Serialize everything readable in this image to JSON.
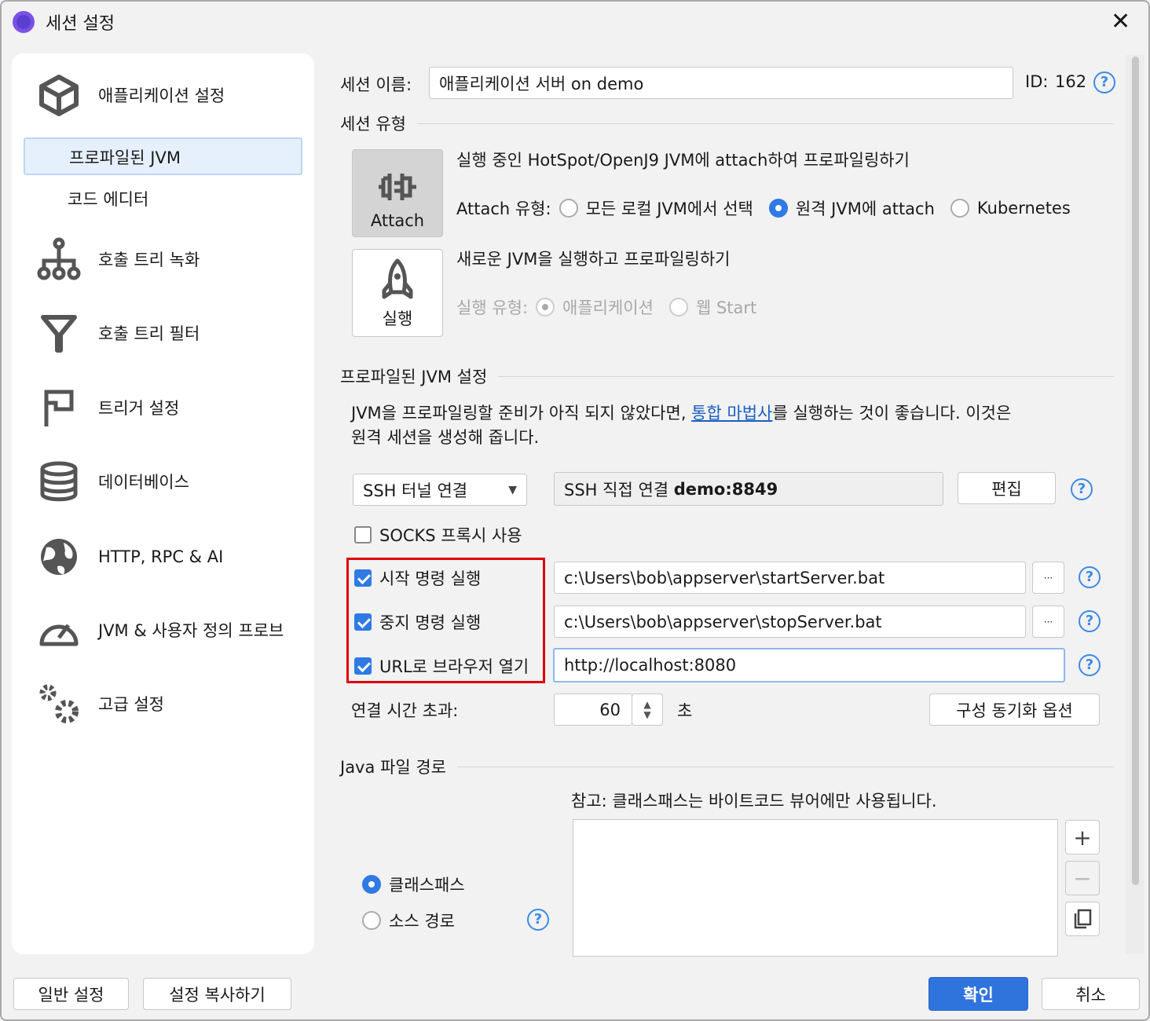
{
  "window": {
    "title": "세션 설정",
    "close": "✕"
  },
  "sidebar": {
    "app_settings": "애플리케이션 설정",
    "sub_items": [
      "프로파일된 JVM",
      "코드 에디터"
    ],
    "items": [
      "호출 트리 녹화",
      "호출 트리 필터",
      "트리거 설정",
      "데이터베이스",
      "HTTP, RPC & AI",
      "JVM & 사용자 정의 프로브",
      "고급 설정"
    ]
  },
  "session": {
    "name_label": "세션 이름:",
    "name_value": "애플리케이션 서버 on demo",
    "id_label": "ID:",
    "id_value": "162"
  },
  "session_type": {
    "header": "세션 유형",
    "attach_tile": "Attach",
    "attach_desc": "실행 중인 HotSpot/OpenJ9 JVM에 attach하여 프로파일링하기",
    "attach_type_label": "Attach 유형:",
    "attach_options": [
      "모든 로컬 JVM에서 선택",
      "원격 JVM에 attach",
      "Kubernetes"
    ],
    "launch_tile": "실행",
    "launch_desc": "새로운 JVM을 실행하고 프로파일링하기",
    "launch_type_label": "실행 유형:",
    "launch_options": [
      "애플리케이션",
      "웹 Start"
    ]
  },
  "jvm": {
    "header": "프로파일된 JVM 설정",
    "info_pre": "JVM을 프로파일링할 준비가 아직 되지 않았다면, ",
    "info_link": "통합 마법사",
    "info_post": "를 실행하는 것이 좋습니다. 이것은",
    "info_line2": "원격 세션을 생성해 줍니다.",
    "connection_select": "SSH 터널 연결",
    "connection_prefix": "SSH 직접 연결 ",
    "connection_host": "demo:8849",
    "edit_button": "편집",
    "socks_label": "SOCKS 프록시 사용",
    "start_label": "시작 명령 실행",
    "start_value": "c:\\Users\\bob\\appserver\\startServer.bat",
    "stop_label": "중지 명령 실행",
    "stop_value": "c:\\Users\\bob\\appserver\\stopServer.bat",
    "url_label": "URL로 브라우저 열기",
    "url_value": "http://localhost:8080",
    "browse": "···",
    "timeout_label": "연결 시간 초과:",
    "timeout_value": "60",
    "timeout_unit": "초",
    "sync_button": "구성 동기화 옵션"
  },
  "java_path": {
    "header": "Java 파일 경로",
    "note": "참고: 클래스패스는 바이트코드 뷰어에만 사용됩니다.",
    "options": [
      "클래스패스",
      "소스 경로"
    ]
  },
  "footer": {
    "general": "일반 설정",
    "copy": "설정 복사하기",
    "ok": "확인",
    "cancel": "취소"
  },
  "colors": {
    "accent": "#2f7ae5",
    "highlight": "#e00000"
  }
}
